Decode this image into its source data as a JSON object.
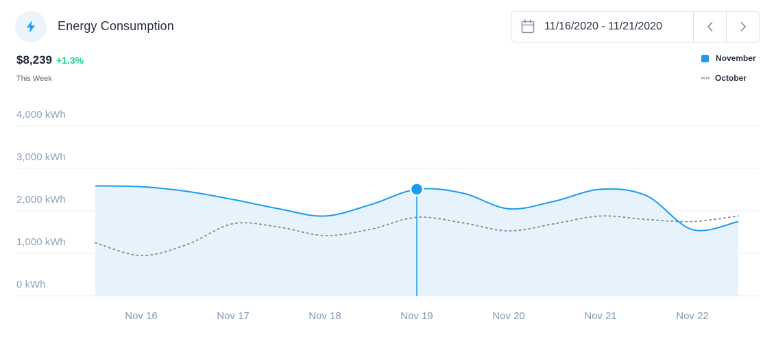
{
  "header": {
    "title": "Energy Consumption",
    "icon": "lightning-bolt-icon",
    "date_range": "11/16/2020 - 11/21/2020"
  },
  "summary": {
    "total": "$8,239",
    "change": "+1.3%",
    "period": "This Week"
  },
  "colors": {
    "accent": "#1a9bf0",
    "fill": "#e6f3fd",
    "secondary": "#7c93a8",
    "positive": "#1fd18c"
  },
  "chart_data": {
    "type": "area",
    "x": [
      "Nov 16",
      "Nov 17",
      "Nov 18",
      "Nov 19",
      "Nov 20",
      "Nov 21",
      "Nov 22"
    ],
    "yticks": [
      "0 kWh",
      "1,000 kWh",
      "2,000 kWh",
      "3,000 kWh",
      "4,000 kWh"
    ],
    "ylim": [
      0,
      4000
    ],
    "series": [
      {
        "name": "November",
        "style": "solid-area",
        "points": [
          [
            -0.5,
            2590
          ],
          [
            0,
            2570
          ],
          [
            0.5,
            2460
          ],
          [
            1,
            2270
          ],
          [
            1.5,
            2050
          ],
          [
            2,
            1880
          ],
          [
            2.5,
            2150
          ],
          [
            3,
            2510
          ],
          [
            3.5,
            2420
          ],
          [
            4,
            2050
          ],
          [
            4.5,
            2230
          ],
          [
            5,
            2510
          ],
          [
            5.5,
            2360
          ],
          [
            6,
            1560
          ],
          [
            6.5,
            1750
          ]
        ]
      },
      {
        "name": "October",
        "style": "dotted",
        "points": [
          [
            -0.5,
            1250
          ],
          [
            0,
            950
          ],
          [
            0.5,
            1210
          ],
          [
            1,
            1700
          ],
          [
            1.5,
            1620
          ],
          [
            2,
            1420
          ],
          [
            2.5,
            1570
          ],
          [
            3,
            1850
          ],
          [
            3.5,
            1720
          ],
          [
            4,
            1530
          ],
          [
            4.5,
            1700
          ],
          [
            5,
            1880
          ],
          [
            5.5,
            1800
          ],
          [
            6,
            1750
          ],
          [
            6.5,
            1880
          ]
        ]
      }
    ],
    "highlight": {
      "x": "Nov 19",
      "value": 2510,
      "series": "November"
    },
    "legend": [
      "November",
      "October"
    ],
    "legend_position": "top-right",
    "grid": true
  }
}
